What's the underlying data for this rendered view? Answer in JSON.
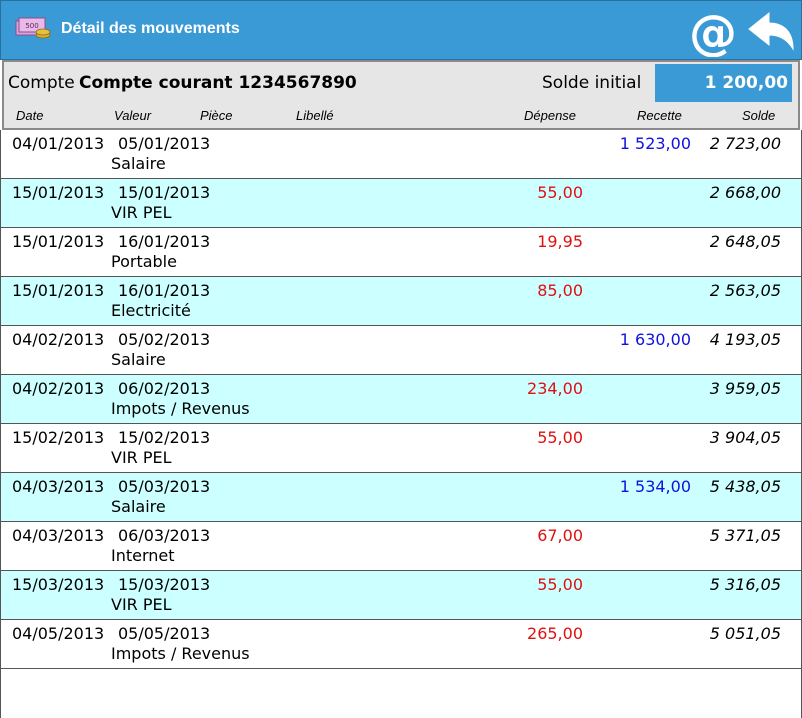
{
  "title": "Détail des mouvements",
  "header": {
    "compte_label": "Compte",
    "compte_name": "Compte courant 1234567890",
    "solde_initial_label": "Solde initial",
    "solde_initial_value": "1 200,00"
  },
  "columns": {
    "date": "Date",
    "valeur": "Valeur",
    "piece": "Pièce",
    "libelle": "Libellé",
    "depense": "Dépense",
    "recette": "Recette",
    "solde": "Solde"
  },
  "icons": {
    "app": "money-icon",
    "email": "at-sign-icon",
    "back": "back-arrow-icon"
  },
  "colors": {
    "accent": "#3a9ad6",
    "row_alt": "#ccffff",
    "expense": "#e01010",
    "income": "#1010e0"
  },
  "rows": [
    {
      "date": "04/01/2013",
      "valeur": "05/01/2013",
      "libelle": "Salaire",
      "depense": "",
      "recette": "1 523,00",
      "solde": "2 723,00"
    },
    {
      "date": "15/01/2013",
      "valeur": "15/01/2013",
      "libelle": "VIR PEL",
      "depense": "55,00",
      "recette": "",
      "solde": "2 668,00"
    },
    {
      "date": "15/01/2013",
      "valeur": "16/01/2013",
      "libelle": "Portable",
      "depense": "19,95",
      "recette": "",
      "solde": "2 648,05"
    },
    {
      "date": "15/01/2013",
      "valeur": "16/01/2013",
      "libelle": "Electricité",
      "depense": "85,00",
      "recette": "",
      "solde": "2 563,05"
    },
    {
      "date": "04/02/2013",
      "valeur": "05/02/2013",
      "libelle": "Salaire",
      "depense": "",
      "recette": "1 630,00",
      "solde": "4 193,05"
    },
    {
      "date": "04/02/2013",
      "valeur": "06/02/2013",
      "libelle": "Impots / Revenus",
      "depense": "234,00",
      "recette": "",
      "solde": "3 959,05"
    },
    {
      "date": "15/02/2013",
      "valeur": "15/02/2013",
      "libelle": "VIR PEL",
      "depense": "55,00",
      "recette": "",
      "solde": "3 904,05"
    },
    {
      "date": "04/03/2013",
      "valeur": "05/03/2013",
      "libelle": "Salaire",
      "depense": "",
      "recette": "1 534,00",
      "solde": "5 438,05"
    },
    {
      "date": "04/03/2013",
      "valeur": "06/03/2013",
      "libelle": "Internet",
      "depense": "67,00",
      "recette": "",
      "solde": "5 371,05"
    },
    {
      "date": "15/03/2013",
      "valeur": "15/03/2013",
      "libelle": "VIR PEL",
      "depense": "55,00",
      "recette": "",
      "solde": "5 316,05"
    },
    {
      "date": "04/05/2013",
      "valeur": "05/05/2013",
      "libelle": "Impots / Revenus",
      "depense": "265,00",
      "recette": "",
      "solde": "5 051,05"
    }
  ]
}
